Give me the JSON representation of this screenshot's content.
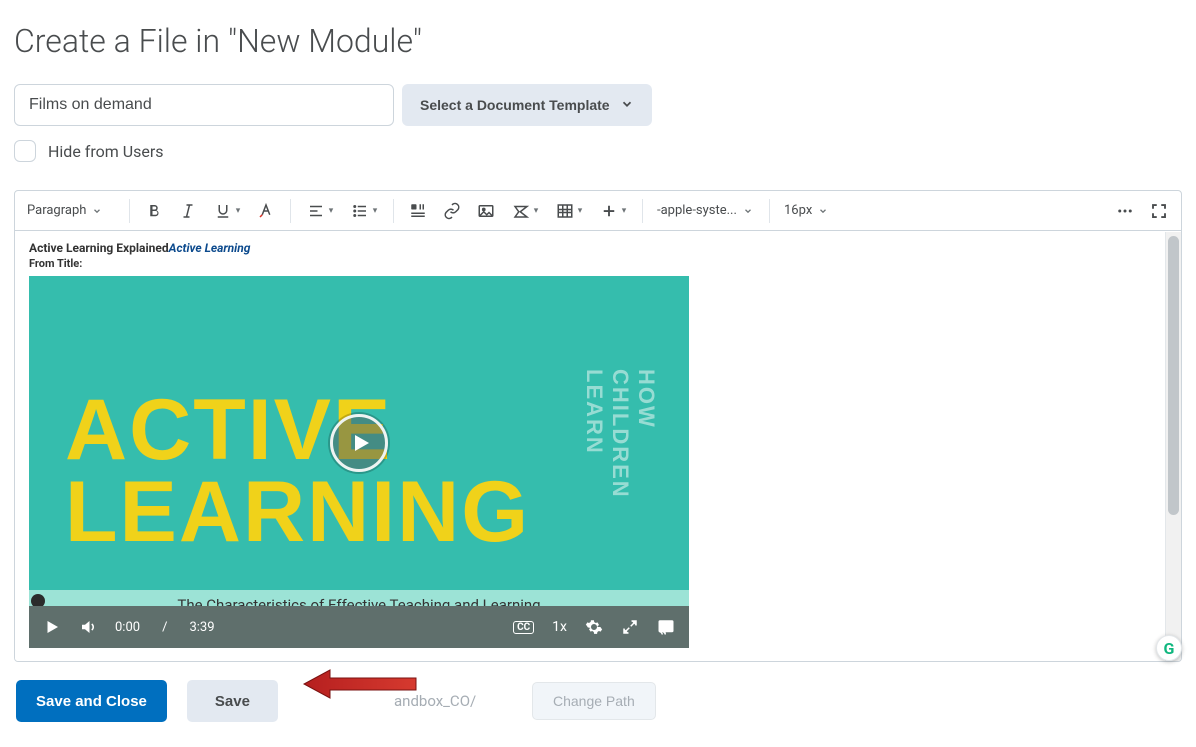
{
  "page": {
    "title": "Create a File in \"New Module\""
  },
  "form": {
    "title_value": "Films on demand",
    "template_button": "Select a Document Template",
    "hide_label": "Hide from Users"
  },
  "toolbar": {
    "paragraph": "Paragraph",
    "font": "-apple-syste...",
    "size": "16px"
  },
  "content": {
    "segment_prefix": "Active Learning Explained",
    "segment_link": "Active Learning",
    "from_title": "From Title:",
    "video_main": "ACTIVE\nLEARNING",
    "video_side": "HOW CHILDREN LEARN",
    "subtitle": "The Characteristics of Effective Teaching and Learning"
  },
  "player": {
    "current": "0:00",
    "duration": "3:39",
    "cc": "CC",
    "speed": "1x"
  },
  "footer": {
    "save_close": "Save and Close",
    "save": "Save",
    "path_fragment": "andbox_CO/",
    "change_path": "Change Path"
  },
  "badge": {
    "letter": "G"
  }
}
